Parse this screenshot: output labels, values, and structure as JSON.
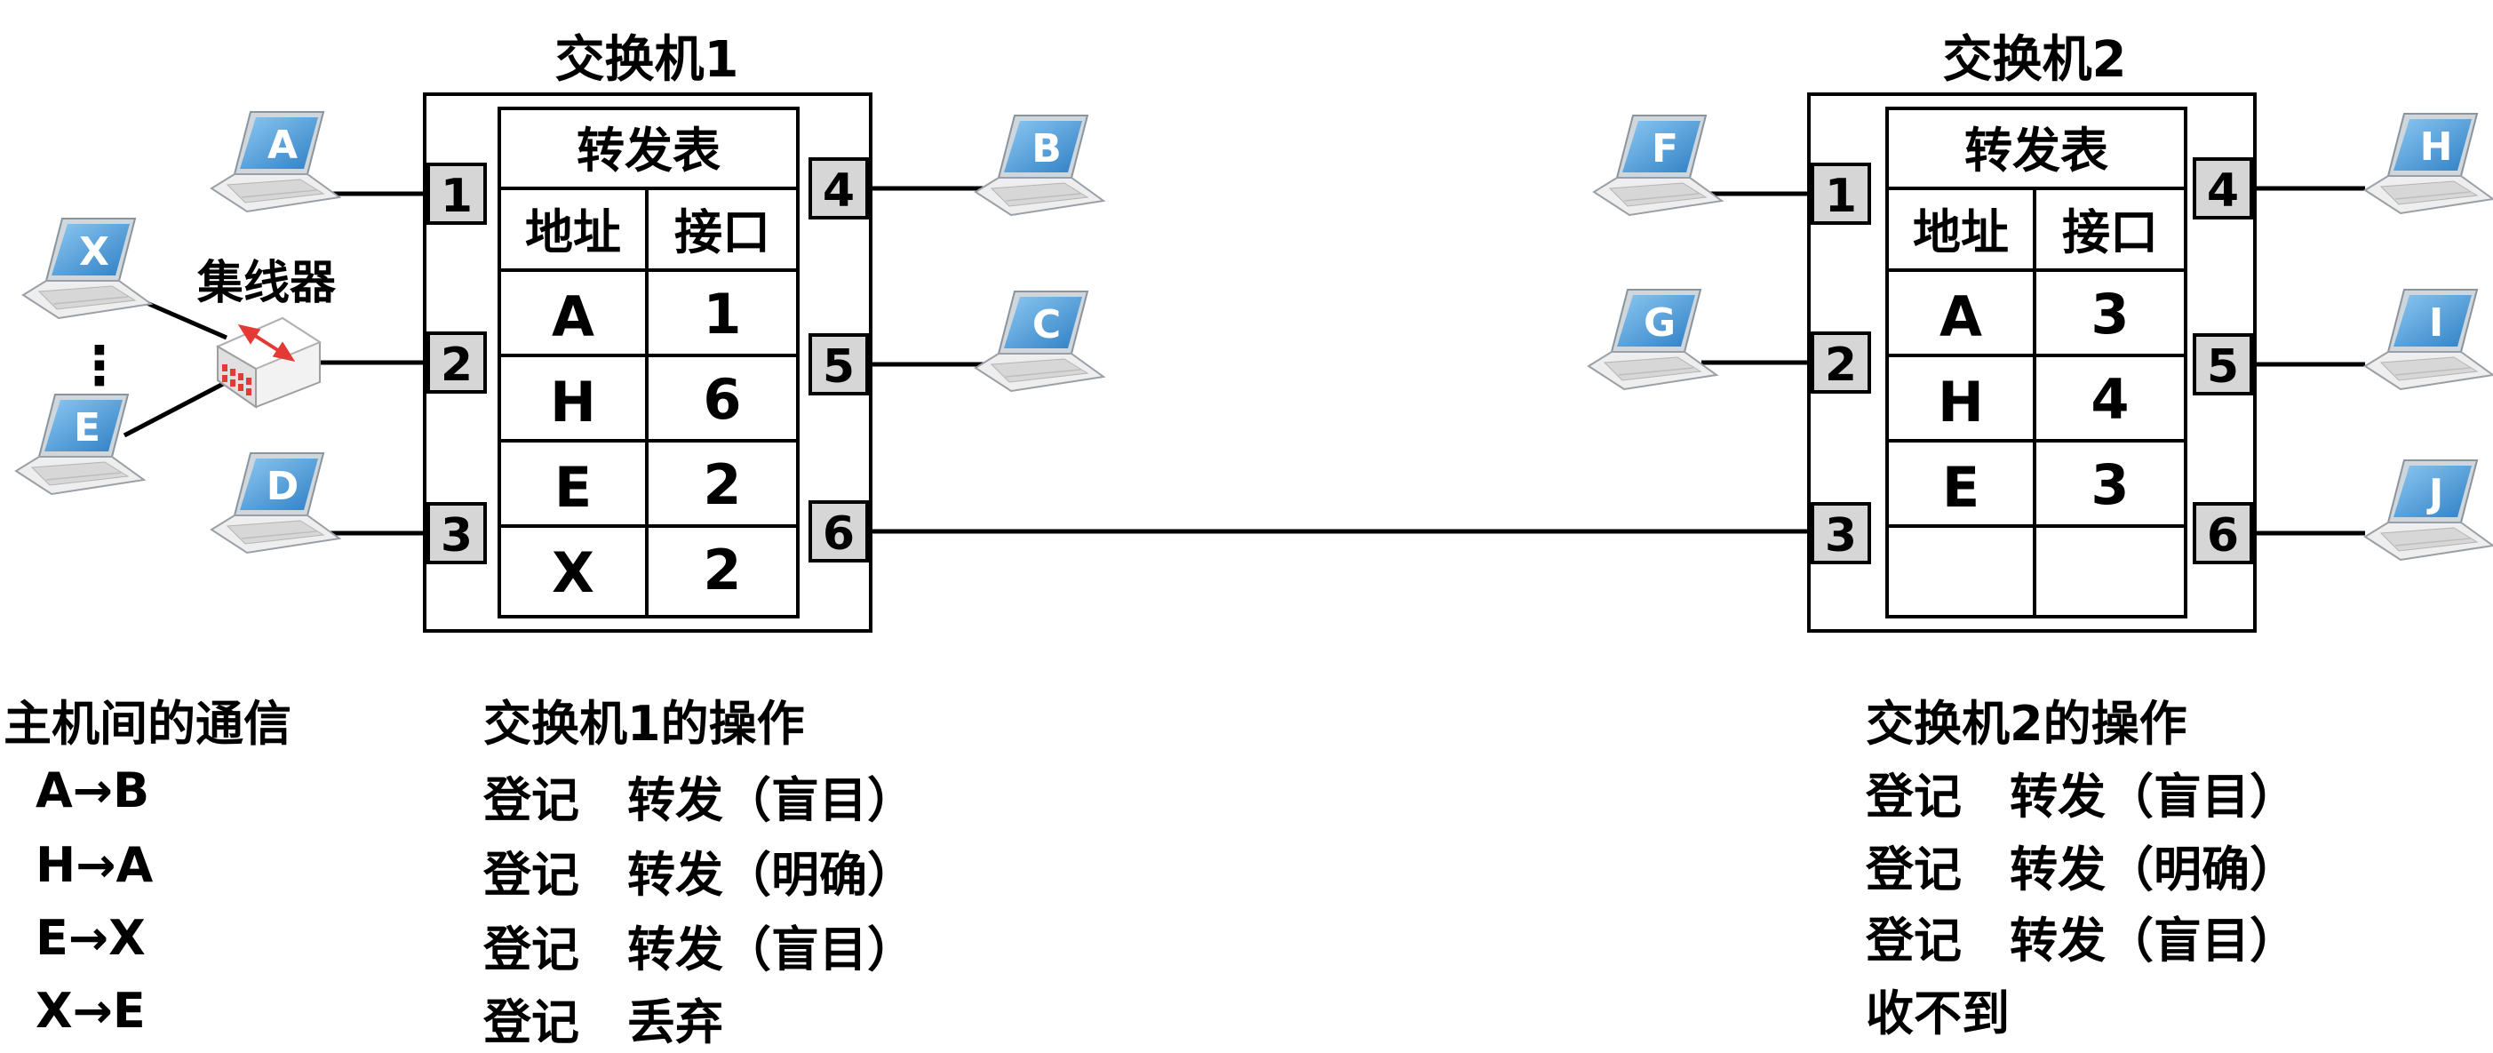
{
  "switch1": {
    "title": "交换机1",
    "table_title": "转发表",
    "col_addr": "地址",
    "col_port": "接口",
    "rows": [
      {
        "addr": "A",
        "port": "1"
      },
      {
        "addr": "H",
        "port": "6"
      },
      {
        "addr": "E",
        "port": "2"
      },
      {
        "addr": "X",
        "port": "2"
      }
    ],
    "ports_left": [
      "1",
      "2",
      "3"
    ],
    "ports_right": [
      "4",
      "5",
      "6"
    ]
  },
  "switch2": {
    "title": "交换机2",
    "table_title": "转发表",
    "col_addr": "地址",
    "col_port": "接口",
    "rows": [
      {
        "addr": "A",
        "port": "3"
      },
      {
        "addr": "H",
        "port": "4"
      },
      {
        "addr": "E",
        "port": "3"
      },
      {
        "addr": "",
        "port": ""
      }
    ],
    "ports_left": [
      "1",
      "2",
      "3"
    ],
    "ports_right": [
      "4",
      "5",
      "6"
    ]
  },
  "hub": {
    "label": "集线器",
    "dots": "⋮"
  },
  "hosts": {
    "A": "A",
    "B": "B",
    "C": "C",
    "D": "D",
    "E": "E",
    "X": "X",
    "F": "F",
    "G": "G",
    "H": "H",
    "I": "I",
    "J": "J"
  },
  "communication": {
    "title": "主机间的通信",
    "items": [
      "A→B",
      "H→A",
      "E→X",
      "X→E"
    ]
  },
  "switch1_ops": {
    "title": "交换机1的操作",
    "items": [
      "登记　转发（盲目）",
      "登记　转发（明确）",
      "登记　转发（盲目）",
      "登记　丢弃"
    ]
  },
  "switch2_ops": {
    "title": "交换机2的操作",
    "items": [
      "登记　转发（盲目）",
      "登记　转发（明确）",
      "登记　转发（盲目）",
      "收不到"
    ]
  },
  "colors": {
    "laptop_screen": "#5aa9e6",
    "laptop_screen_dark": "#2f7fc4",
    "laptop_body": "#e6e6e6",
    "port_fill": "#d6d6d6",
    "hub_accent": "#e53935"
  }
}
